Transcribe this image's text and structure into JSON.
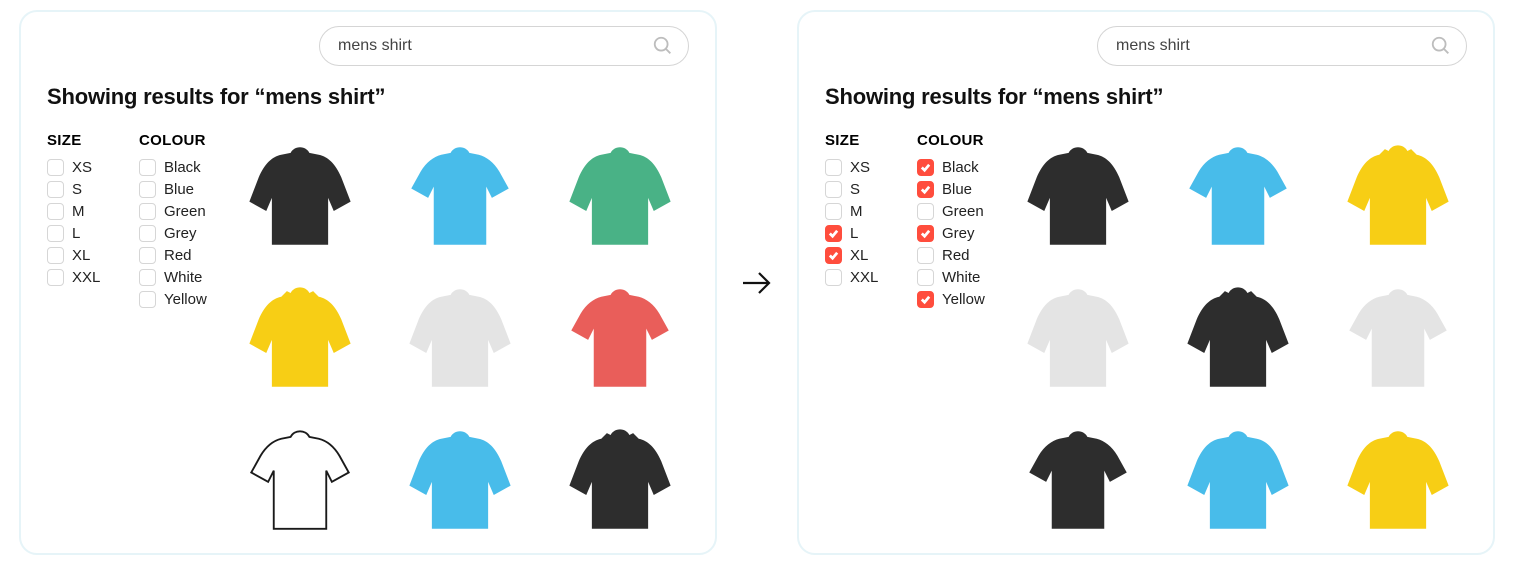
{
  "colors": {
    "black": "#2d2d2d",
    "blue": "#48bcea",
    "green": "#49b286",
    "grey": "#e4e4e4",
    "red": "#e95e5a",
    "white": "#ffffff",
    "yellow": "#f7ce15",
    "checkbox_accent": "#ff4d3d",
    "stroke": "#1a1a1a"
  },
  "panels": [
    {
      "id": "before",
      "search": {
        "value": "mens shirt"
      },
      "heading": "Showing results for “mens shirt”",
      "filters": {
        "size": {
          "title": "SIZE",
          "options": [
            {
              "label": "XS",
              "checked": false
            },
            {
              "label": "S",
              "checked": false
            },
            {
              "label": "M",
              "checked": false
            },
            {
              "label": "L",
              "checked": false
            },
            {
              "label": "XL",
              "checked": false
            },
            {
              "label": "XXL",
              "checked": false
            }
          ]
        },
        "colour": {
          "title": "COLOUR",
          "options": [
            {
              "label": "Black",
              "checked": false
            },
            {
              "label": "Blue",
              "checked": false
            },
            {
              "label": "Green",
              "checked": false
            },
            {
              "label": "Grey",
              "checked": false
            },
            {
              "label": "Red",
              "checked": false
            },
            {
              "label": "White",
              "checked": false
            },
            {
              "label": "Yellow",
              "checked": false
            }
          ]
        }
      },
      "products": [
        {
          "color": "black",
          "style": "long"
        },
        {
          "color": "blue",
          "style": "short"
        },
        {
          "color": "green",
          "style": "long"
        },
        {
          "color": "yellow",
          "style": "collar"
        },
        {
          "color": "grey",
          "style": "long"
        },
        {
          "color": "red",
          "style": "short"
        },
        {
          "color": "white",
          "style": "short"
        },
        {
          "color": "blue",
          "style": "long"
        },
        {
          "color": "black",
          "style": "collar"
        }
      ]
    },
    {
      "id": "after",
      "search": {
        "value": "mens shirt"
      },
      "heading": "Showing results for “mens shirt”",
      "filters": {
        "size": {
          "title": "SIZE",
          "options": [
            {
              "label": "XS",
              "checked": false
            },
            {
              "label": "S",
              "checked": false
            },
            {
              "label": "M",
              "checked": false
            },
            {
              "label": "L",
              "checked": true
            },
            {
              "label": "XL",
              "checked": true
            },
            {
              "label": "XXL",
              "checked": false
            }
          ]
        },
        "colour": {
          "title": "COLOUR",
          "options": [
            {
              "label": "Black",
              "checked": true
            },
            {
              "label": "Blue",
              "checked": true
            },
            {
              "label": "Green",
              "checked": false
            },
            {
              "label": "Grey",
              "checked": true
            },
            {
              "label": "Red",
              "checked": false
            },
            {
              "label": "White",
              "checked": false
            },
            {
              "label": "Yellow",
              "checked": true
            }
          ]
        }
      },
      "products": [
        {
          "color": "black",
          "style": "long"
        },
        {
          "color": "blue",
          "style": "short"
        },
        {
          "color": "yellow",
          "style": "collar"
        },
        {
          "color": "grey",
          "style": "long"
        },
        {
          "color": "black",
          "style": "collar"
        },
        {
          "color": "grey",
          "style": "short"
        },
        {
          "color": "black",
          "style": "short"
        },
        {
          "color": "blue",
          "style": "long"
        },
        {
          "color": "yellow",
          "style": "long"
        }
      ]
    }
  ]
}
